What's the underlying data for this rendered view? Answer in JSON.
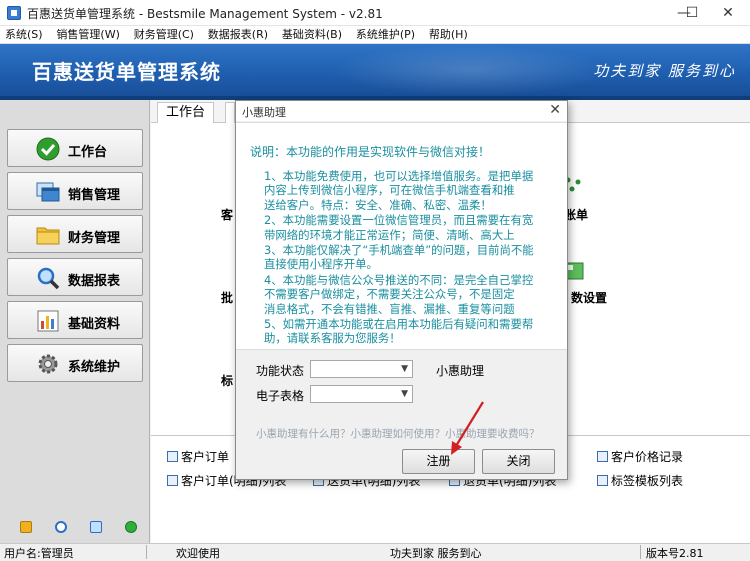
{
  "window": {
    "title": "百惠送货单管理系统 - Bestsmile Management System - v2.81",
    "minimize": "—",
    "maximize": "☐",
    "close": "✕"
  },
  "menu": [
    "系统(S)",
    "销售管理(W)",
    "财务管理(C)",
    "数据报表(R)",
    "基础资料(B)",
    "系统维护(P)",
    "帮助(H)"
  ],
  "banner": {
    "title": "百惠送货单管理系统",
    "slogan": "功夫到家  服务到心"
  },
  "sidebar": {
    "items": [
      {
        "label": "工作台",
        "icon": "check-icon",
        "color": "#2f9e2f"
      },
      {
        "label": "销售管理",
        "icon": "windows-icon",
        "color": "#2f6fb3"
      },
      {
        "label": "财务管理",
        "icon": "folder-icon",
        "color": "#f2c33a"
      },
      {
        "label": "数据报表",
        "icon": "magnifier-icon",
        "color": "#3a7fd0"
      },
      {
        "label": "基础资料",
        "icon": "chart-icon",
        "color": "#d04a3a"
      },
      {
        "label": "系统维护",
        "icon": "gear-icon",
        "color": "#888888"
      }
    ]
  },
  "tabs": {
    "active": "工作台"
  },
  "workbench": {
    "left_fragments": [
      "客",
      "批",
      "标"
    ],
    "right_fragments": [
      "账单",
      "数设置"
    ]
  },
  "quick_links": {
    "row1": [
      "客户订单",
      "客户价格记录"
    ],
    "row2": [
      "客户订单(明细)列表",
      "送货单(明细)列表",
      "退货单(明细)列表",
      "标签模板列表"
    ]
  },
  "status": {
    "user": "用户名:管理员",
    "welcome": "欢迎使用",
    "slogan": "功夫到家 服务到心",
    "version": "版本号2.81"
  },
  "dialog": {
    "title": "小惠助理",
    "heading": "说明：本功能的作用是实现软件与微信对接！",
    "items": [
      [
        "1、本功能免费使用，也可以选择增值服务。是把单据",
        "内容上传到微信小程序，可在微信手机端查看和推",
        "送给客户。特点：安全、准确、私密、温柔！"
      ],
      [
        "2、本功能需要设置一位微信管理员，而且需要在有宽",
        "带网络的环境才能正常运作；简便、清晰、高大上"
      ],
      [
        "3、本功能仅解决了“手机端查单”的问题，目前尚不能",
        "直接使用小程序开单。"
      ],
      [
        "4、本功能与微信公众号推送的不同：是完全自己掌控",
        "不需要客户做绑定，不需要关注公众号，不是固定",
        "消息格式，不会有错推、盲推、漏推、重复等问题"
      ],
      [
        "5、如需开通本功能或在启用本功能后有疑问和需要帮",
        "助，请联系客服为您服务！"
      ]
    ],
    "status_label": "功能状态",
    "table_label": "电子表格",
    "assistant_label": "小惠助理",
    "help_link": "小惠助理有什么用？小惠助理如何使用？小惠助理要收费吗？",
    "register_label": "注册",
    "close_label": "关闭"
  },
  "colors": {
    "banner": "#1f5fb0",
    "dialog_text": "#1a8fa0",
    "arrow": "#d21f1f"
  }
}
